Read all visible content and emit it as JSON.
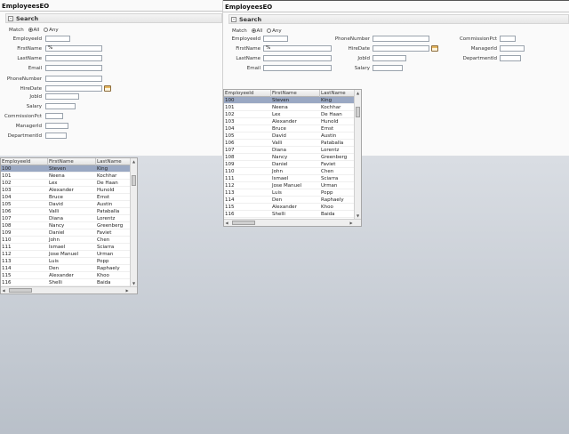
{
  "left": {
    "title": "EmployeesEO",
    "search_label": "Search",
    "toggle_symbol": "-",
    "match_label": "Match",
    "match_all": "All",
    "match_any": "Any",
    "fields": [
      {
        "label": "EmployeeId",
        "value": ""
      },
      {
        "label": "FirstName",
        "value": "%"
      },
      {
        "label": "LastName",
        "value": ""
      },
      {
        "label": "Email",
        "value": ""
      },
      {
        "label": "PhoneNumber",
        "value": ""
      },
      {
        "label": "HireDate",
        "value": ""
      },
      {
        "label": "JobId",
        "value": ""
      },
      {
        "label": "Salary",
        "value": ""
      },
      {
        "label": "CommissionPct",
        "value": ""
      },
      {
        "label": "ManagerId",
        "value": ""
      },
      {
        "label": "DepartmentId",
        "value": ""
      }
    ]
  },
  "right": {
    "title": "EmployeesEO",
    "search_label": "Search",
    "toggle_symbol": "-",
    "match_label": "Match",
    "match_all": "All",
    "match_any": "Any",
    "col1": [
      {
        "label": "EmployeeId",
        "value": ""
      },
      {
        "label": "FirstName",
        "value": "%"
      },
      {
        "label": "LastName",
        "value": ""
      },
      {
        "label": "Email",
        "value": ""
      }
    ],
    "col2": [
      {
        "label": "PhoneNumber",
        "value": ""
      },
      {
        "label": "HireDate",
        "value": ""
      },
      {
        "label": "JobId",
        "value": ""
      },
      {
        "label": "Salary",
        "value": ""
      }
    ],
    "col3": [
      {
        "label": "CommissionPct",
        "value": ""
      },
      {
        "label": "ManagerId",
        "value": ""
      },
      {
        "label": "DepartmentId",
        "value": ""
      }
    ]
  },
  "table": {
    "columns": [
      "EmployeeId",
      "FirstName",
      "LastName"
    ],
    "rows": [
      [
        "100",
        "Steven",
        "King"
      ],
      [
        "101",
        "Neena",
        "Kochhar"
      ],
      [
        "102",
        "Lex",
        "De Haan"
      ],
      [
        "103",
        "Alexander",
        "Hunold"
      ],
      [
        "104",
        "Bruce",
        "Ernst"
      ],
      [
        "105",
        "David",
        "Austin"
      ],
      [
        "106",
        "Valli",
        "Pataballa"
      ],
      [
        "107",
        "Diana",
        "Lorentz"
      ],
      [
        "108",
        "Nancy",
        "Greenberg"
      ],
      [
        "109",
        "Daniel",
        "Faviet"
      ],
      [
        "110",
        "John",
        "Chen"
      ],
      [
        "111",
        "Ismael",
        "Sciarra"
      ],
      [
        "112",
        "Jose Manuel",
        "Urman"
      ],
      [
        "113",
        "Luis",
        "Popp"
      ],
      [
        "114",
        "Den",
        "Raphaely"
      ],
      [
        "115",
        "Alexander",
        "Khoo"
      ],
      [
        "116",
        "Shelli",
        "Baida"
      ]
    ],
    "selected_row": 0
  },
  "icons": {
    "calendar": "calendar-icon",
    "collapse": "collapse-toggle-icon",
    "scroll_up": "scroll-up-icon",
    "scroll_down": "scroll-down-icon",
    "scroll_left": "scroll-left-icon",
    "scroll_right": "scroll-right-icon"
  },
  "colors": {
    "selected_row": "#9aa8c3",
    "input_border": "#9aa3ad"
  }
}
